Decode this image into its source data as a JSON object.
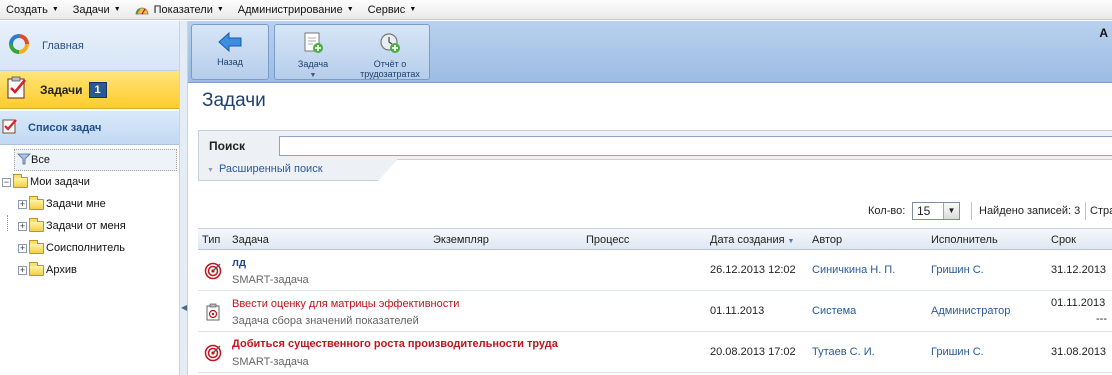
{
  "menubar": {
    "items": [
      {
        "label": "Создать"
      },
      {
        "label": "Задачи"
      },
      {
        "label": "Показатели"
      },
      {
        "label": "Администрирование"
      },
      {
        "label": "Сервис"
      }
    ]
  },
  "sidebar": {
    "home_label": "Главная",
    "tasks_label": "Задачи",
    "tasks_badge": "1",
    "tasklist_label": "Список задач",
    "tree": {
      "all": "Все",
      "my_tasks": "Мои задачи",
      "children": [
        "Задачи мне",
        "Задачи от меня",
        "Соисполнитель",
        "Архив"
      ]
    }
  },
  "toolbar": {
    "back_label": "Назад",
    "task_label": "Задача",
    "report_label_1": "Отчёт о",
    "report_label_2": "трудозатратах",
    "corner_letter": "А"
  },
  "main": {
    "title": "Задачи",
    "search_label": "Поиск",
    "search_value": "",
    "advanced_search": "Расширенный поиск",
    "count_label": "Кол-во:",
    "count_value": "15",
    "found_label": "Найдено записей: 3",
    "page_label": "Стра"
  },
  "grid": {
    "columns": [
      "Тип",
      "Задача",
      "Экземпляр",
      "Процесс",
      "Дата создания",
      "Автор",
      "Исполнитель",
      "Срок"
    ],
    "rows": [
      {
        "type_icon": "target-icon",
        "title": "лд",
        "subtitle": "SMART-задача",
        "created": "26.12.2013 12:02",
        "author": "Синичкина Н. П.",
        "assignee": "Гришин С.",
        "deadline": "31.12.2013"
      },
      {
        "type_icon": "clipboard-icon",
        "title": "Ввести оценку для матрицы эффективности",
        "subtitle": "Задача сбора значений показателей",
        "created": "01.11.2013",
        "author": "Система",
        "assignee": "Администратор",
        "deadline": "01.11.2013",
        "deadline_extra": "---"
      },
      {
        "type_icon": "target-icon",
        "title": "Добиться существенного роста производительности труда",
        "subtitle": "SMART-задача",
        "created": "20.08.2013 17:02",
        "author": "Тутаев С. И.",
        "assignee": "Гришин С.",
        "deadline": "31.08.2013"
      }
    ]
  },
  "colors": {
    "accent_blue": "#2a5a9a",
    "task_red": "#c0141c",
    "active_nav_yellow": "#ffcb2f",
    "badge_blue": "#2a5a96"
  }
}
